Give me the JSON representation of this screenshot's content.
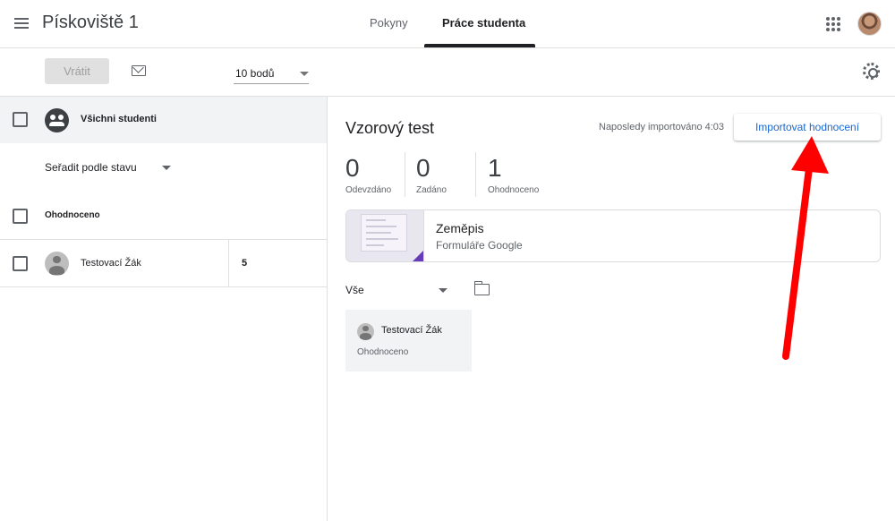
{
  "header": {
    "title": "Pískoviště 1",
    "tabs": [
      {
        "label": "Pokyny",
        "active": false
      },
      {
        "label": "Práce studenta",
        "active": true
      }
    ],
    "icons": [
      "menu-icon",
      "apps-icon",
      "account-avatar"
    ]
  },
  "toolbar": {
    "return_label": "Vrátit",
    "points_value": "10 bodů",
    "icons": [
      "mail-icon",
      "gear-icon"
    ]
  },
  "left_panel": {
    "all_students_label": "Všichni studenti",
    "sort_label": "Seřadit podle stavu",
    "section_label": "Ohodnoceno",
    "students": [
      {
        "name": "Testovací Žák",
        "grade": "5"
      }
    ]
  },
  "main": {
    "assignment_title": "Vzorový test",
    "import_status": "Naposledy importováno 4:03",
    "import_button": "Importovat hodnocení",
    "stats": [
      {
        "value": "0",
        "label": "Odevzdáno"
      },
      {
        "value": "0",
        "label": "Zadáno"
      },
      {
        "value": "1",
        "label": "Ohodnoceno"
      }
    ],
    "attachment": {
      "title": "Zeměpis",
      "subtitle": "Formuláře Google"
    },
    "filter_label": "Vše",
    "student_card": {
      "name": "Testovací Žák",
      "status": "Ohodnoceno"
    }
  },
  "colors": {
    "accent_blue": "#1967d2",
    "forms_purple": "#673ab7",
    "annotation_red": "#ff0000"
  }
}
